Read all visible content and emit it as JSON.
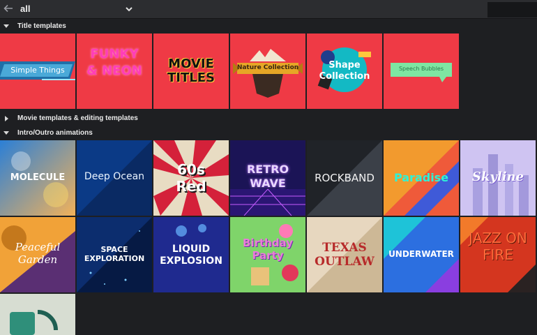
{
  "topbar": {
    "path_label": "all",
    "search_value": ""
  },
  "sections": [
    {
      "label": "Title templates",
      "expanded": true
    },
    {
      "label": "Movie templates & editing templates",
      "expanded": false
    },
    {
      "label": "Intro/Outro animations",
      "expanded": true
    }
  ],
  "title_templates": [
    {
      "label": "Simple Things"
    },
    {
      "label": "FUNKY & NEON"
    },
    {
      "label": "MOVIE TITLES"
    },
    {
      "label": "Nature Collection"
    },
    {
      "label": "Shape Collection"
    },
    {
      "label": "Speech Bubbles"
    }
  ],
  "intro_animations": [
    {
      "label": "MOLECULE"
    },
    {
      "label": "Deep Ocean"
    },
    {
      "label": "60s Red"
    },
    {
      "label": "RETRO WAVE"
    },
    {
      "label": "ROCKBAND"
    },
    {
      "label": "Paradise"
    },
    {
      "label": "Skyline"
    },
    {
      "label": "Peaceful Garden"
    },
    {
      "label": "SPACE EXPLORATION"
    },
    {
      "label": "LIQUID EXPLOSION"
    },
    {
      "label": "Birthday Party"
    },
    {
      "label": "TEXAS OUTLAW"
    },
    {
      "label": "UNDERWATER"
    },
    {
      "label": "JAZZ ON FIRE"
    },
    {
      "label": ""
    }
  ],
  "colors": {
    "background": "#1e1f22",
    "title_tile_red": "#ef3a45",
    "topbar": "#2c2d30"
  }
}
